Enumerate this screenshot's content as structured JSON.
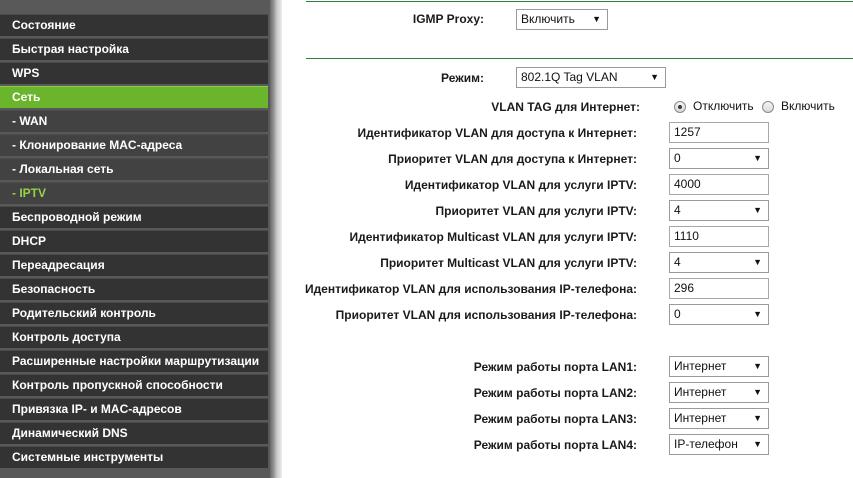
{
  "sidebar": {
    "items": [
      {
        "label": "Состояние"
      },
      {
        "label": "Быстрая настройка"
      },
      {
        "label": "WPS"
      },
      {
        "label": "Сеть"
      },
      {
        "label": "- WAN"
      },
      {
        "label": "- Клонирование MAC-адреса"
      },
      {
        "label": "- Локальная сеть"
      },
      {
        "label": "- IPTV"
      },
      {
        "label": "Беспроводной режим"
      },
      {
        "label": "DHCP"
      },
      {
        "label": "Переадресация"
      },
      {
        "label": "Безопасность"
      },
      {
        "label": "Родительский контроль"
      },
      {
        "label": "Контроль доступа"
      },
      {
        "label": "Расширенные настройки маршрутизации"
      },
      {
        "label": "Контроль пропускной способности"
      },
      {
        "label": "Привязка IP- и MAC-адресов"
      },
      {
        "label": "Динамический DNS"
      },
      {
        "label": "Системные инструменты"
      }
    ],
    "active_color": "#6bb52d",
    "selected_sub_color": "#97d246"
  },
  "igmp": {
    "label": "IGMP Proxy:",
    "value": "Включить"
  },
  "mode": {
    "label": "Режим:",
    "value": "802.1Q Tag VLAN"
  },
  "vlan_tag": {
    "label": "VLAN TAG для Интернет:",
    "option_off": "Отключить",
    "option_on": "Включить",
    "selected": "Отключить"
  },
  "fields": [
    {
      "label": "Идентификатор VLAN для доступа к Интернет:",
      "type": "input",
      "value": "1257"
    },
    {
      "label": "Приоритет VLAN для доступа к Интернет:",
      "type": "select",
      "value": "0"
    },
    {
      "label": "Идентификатор VLAN для услуги IPTV:",
      "type": "input",
      "value": "4000"
    },
    {
      "label": "Приоритет VLAN для услуги IPTV:",
      "type": "select",
      "value": "4"
    },
    {
      "label": "Идентификатор Multicast VLAN для услуги IPTV:",
      "type": "input",
      "value": "1110"
    },
    {
      "label": "Приоритет Multicast VLAN для услуги IPTV:",
      "type": "select",
      "value": "4"
    },
    {
      "label": "Идентификатор VLAN для использования IP-телефона:",
      "type": "input",
      "value": "296"
    },
    {
      "label": "Приоритет VLAN для использования IP-телефона:",
      "type": "select",
      "value": "0"
    }
  ],
  "lan_ports": [
    {
      "label": "Режим работы порта LAN1:",
      "value": "Интернет"
    },
    {
      "label": "Режим работы порта LAN2:",
      "value": "Интернет"
    },
    {
      "label": "Режим работы порта LAN3:",
      "value": "Интернет"
    },
    {
      "label": "Режим работы порта LAN4:",
      "value": "IP-телефон"
    }
  ]
}
